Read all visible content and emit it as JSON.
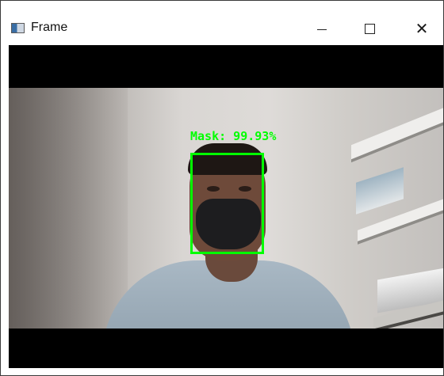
{
  "window": {
    "title": "Frame",
    "icon": "app-window-icon",
    "controls": {
      "minimize_icon": "minimize-icon",
      "maximize_icon": "maximize-icon",
      "close_icon": "close-icon",
      "close_glyph": "✕"
    }
  },
  "video": {
    "detection": {
      "label": "Mask: 99.93%",
      "color": "#00ff00"
    }
  }
}
